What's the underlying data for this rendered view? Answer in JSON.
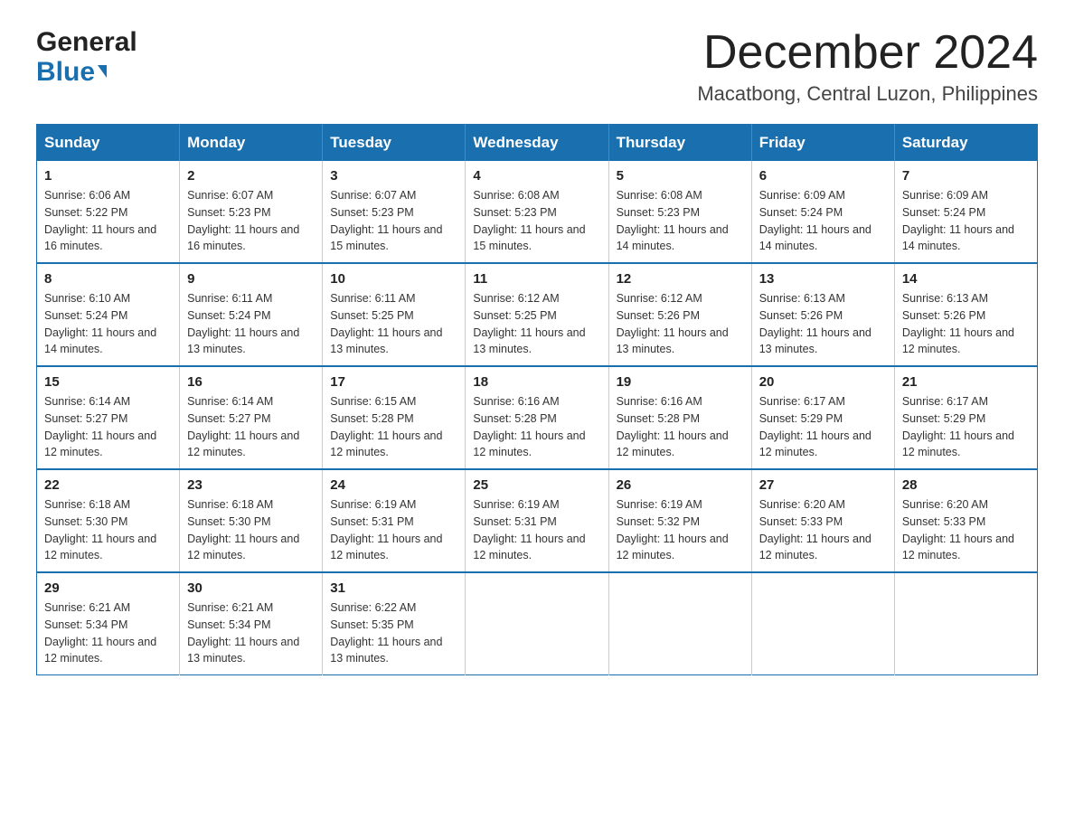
{
  "header": {
    "logo_general": "General",
    "logo_blue": "Blue",
    "month_title": "December 2024",
    "location": "Macatbong, Central Luzon, Philippines"
  },
  "days_of_week": [
    "Sunday",
    "Monday",
    "Tuesday",
    "Wednesday",
    "Thursday",
    "Friday",
    "Saturday"
  ],
  "weeks": [
    [
      {
        "day": "1",
        "sunrise": "6:06 AM",
        "sunset": "5:22 PM",
        "daylight": "11 hours and 16 minutes."
      },
      {
        "day": "2",
        "sunrise": "6:07 AM",
        "sunset": "5:23 PM",
        "daylight": "11 hours and 16 minutes."
      },
      {
        "day": "3",
        "sunrise": "6:07 AM",
        "sunset": "5:23 PM",
        "daylight": "11 hours and 15 minutes."
      },
      {
        "day": "4",
        "sunrise": "6:08 AM",
        "sunset": "5:23 PM",
        "daylight": "11 hours and 15 minutes."
      },
      {
        "day": "5",
        "sunrise": "6:08 AM",
        "sunset": "5:23 PM",
        "daylight": "11 hours and 14 minutes."
      },
      {
        "day": "6",
        "sunrise": "6:09 AM",
        "sunset": "5:24 PM",
        "daylight": "11 hours and 14 minutes."
      },
      {
        "day": "7",
        "sunrise": "6:09 AM",
        "sunset": "5:24 PM",
        "daylight": "11 hours and 14 minutes."
      }
    ],
    [
      {
        "day": "8",
        "sunrise": "6:10 AM",
        "sunset": "5:24 PM",
        "daylight": "11 hours and 14 minutes."
      },
      {
        "day": "9",
        "sunrise": "6:11 AM",
        "sunset": "5:24 PM",
        "daylight": "11 hours and 13 minutes."
      },
      {
        "day": "10",
        "sunrise": "6:11 AM",
        "sunset": "5:25 PM",
        "daylight": "11 hours and 13 minutes."
      },
      {
        "day": "11",
        "sunrise": "6:12 AM",
        "sunset": "5:25 PM",
        "daylight": "11 hours and 13 minutes."
      },
      {
        "day": "12",
        "sunrise": "6:12 AM",
        "sunset": "5:26 PM",
        "daylight": "11 hours and 13 minutes."
      },
      {
        "day": "13",
        "sunrise": "6:13 AM",
        "sunset": "5:26 PM",
        "daylight": "11 hours and 13 minutes."
      },
      {
        "day": "14",
        "sunrise": "6:13 AM",
        "sunset": "5:26 PM",
        "daylight": "11 hours and 12 minutes."
      }
    ],
    [
      {
        "day": "15",
        "sunrise": "6:14 AM",
        "sunset": "5:27 PM",
        "daylight": "11 hours and 12 minutes."
      },
      {
        "day": "16",
        "sunrise": "6:14 AM",
        "sunset": "5:27 PM",
        "daylight": "11 hours and 12 minutes."
      },
      {
        "day": "17",
        "sunrise": "6:15 AM",
        "sunset": "5:28 PM",
        "daylight": "11 hours and 12 minutes."
      },
      {
        "day": "18",
        "sunrise": "6:16 AM",
        "sunset": "5:28 PM",
        "daylight": "11 hours and 12 minutes."
      },
      {
        "day": "19",
        "sunrise": "6:16 AM",
        "sunset": "5:28 PM",
        "daylight": "11 hours and 12 minutes."
      },
      {
        "day": "20",
        "sunrise": "6:17 AM",
        "sunset": "5:29 PM",
        "daylight": "11 hours and 12 minutes."
      },
      {
        "day": "21",
        "sunrise": "6:17 AM",
        "sunset": "5:29 PM",
        "daylight": "11 hours and 12 minutes."
      }
    ],
    [
      {
        "day": "22",
        "sunrise": "6:18 AM",
        "sunset": "5:30 PM",
        "daylight": "11 hours and 12 minutes."
      },
      {
        "day": "23",
        "sunrise": "6:18 AM",
        "sunset": "5:30 PM",
        "daylight": "11 hours and 12 minutes."
      },
      {
        "day": "24",
        "sunrise": "6:19 AM",
        "sunset": "5:31 PM",
        "daylight": "11 hours and 12 minutes."
      },
      {
        "day": "25",
        "sunrise": "6:19 AM",
        "sunset": "5:31 PM",
        "daylight": "11 hours and 12 minutes."
      },
      {
        "day": "26",
        "sunrise": "6:19 AM",
        "sunset": "5:32 PM",
        "daylight": "11 hours and 12 minutes."
      },
      {
        "day": "27",
        "sunrise": "6:20 AM",
        "sunset": "5:33 PM",
        "daylight": "11 hours and 12 minutes."
      },
      {
        "day": "28",
        "sunrise": "6:20 AM",
        "sunset": "5:33 PM",
        "daylight": "11 hours and 12 minutes."
      }
    ],
    [
      {
        "day": "29",
        "sunrise": "6:21 AM",
        "sunset": "5:34 PM",
        "daylight": "11 hours and 12 minutes."
      },
      {
        "day": "30",
        "sunrise": "6:21 AM",
        "sunset": "5:34 PM",
        "daylight": "11 hours and 13 minutes."
      },
      {
        "day": "31",
        "sunrise": "6:22 AM",
        "sunset": "5:35 PM",
        "daylight": "11 hours and 13 minutes."
      },
      null,
      null,
      null,
      null
    ]
  ]
}
